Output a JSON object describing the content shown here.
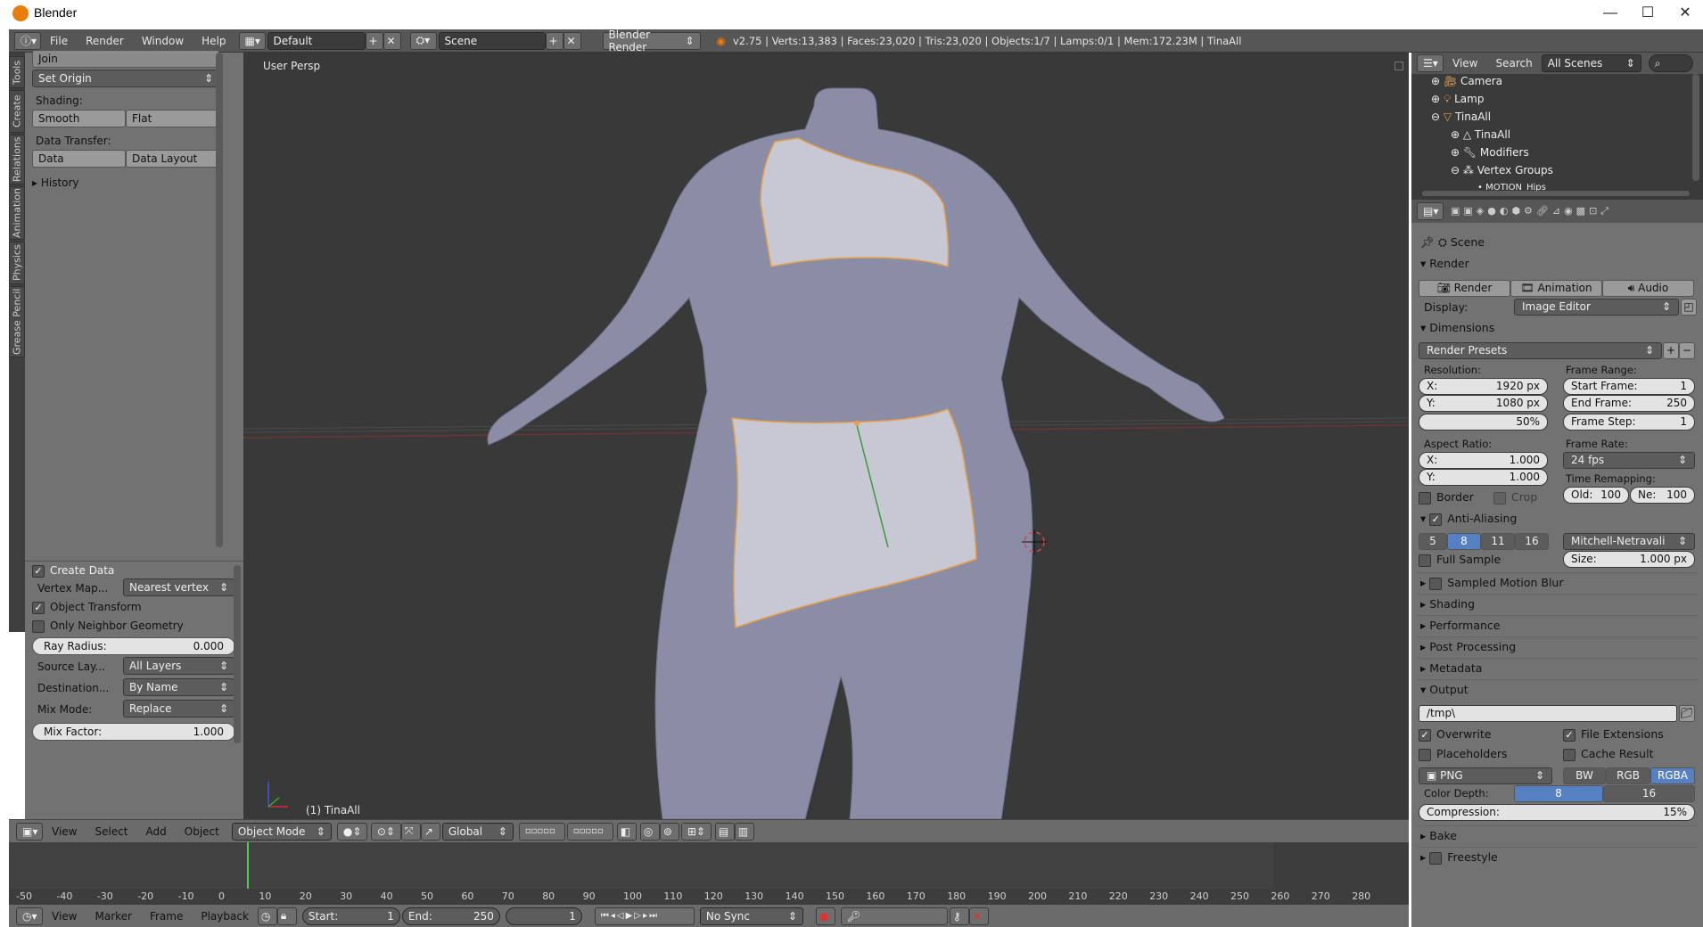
{
  "window": {
    "title": "Blender",
    "min": "—",
    "max": "☐",
    "close": "✕"
  },
  "info": {
    "menus": [
      "File",
      "Render",
      "Window",
      "Help"
    ],
    "layout": "Default",
    "scene": "Scene",
    "engine": "Blender Render",
    "stats": "v2.75 | Verts:13,383 | Faces:23,020 | Tris:23,020 | Objects:1/7 | Lamps:0/1 | Mem:172.23M | TinaAll"
  },
  "lefttabs": [
    "Tools",
    "Create",
    "Relations",
    "Animation",
    "Physics",
    "Grease Pencil"
  ],
  "tools": {
    "join": "Join",
    "set_origin": "Set Origin",
    "shading_label": "Shading:",
    "smooth": "Smooth",
    "flat": "Flat",
    "data_transfer_label": "Data Transfer:",
    "data": "Data",
    "data_layout": "Data Layout",
    "history": "History",
    "create_data": "Create Data",
    "vertex_map_label": "Vertex Map...",
    "vertex_map": "Nearest vertex",
    "object_transform": "Object Transform",
    "only_neighbor": "Only Neighbor Geometry",
    "ray_radius_label": "Ray Radius:",
    "ray_radius": "0.000",
    "source_layers_label": "Source Lay...",
    "source_layers": "All Layers",
    "destination_label": "Destination...",
    "destination": "By Name",
    "mix_mode_label": "Mix Mode:",
    "mix_mode": "Replace",
    "mix_factor_label": "Mix Factor:",
    "mix_factor": "1.000"
  },
  "viewport": {
    "persp": "User Persp",
    "object": "(1) TinaAll"
  },
  "vpheader": {
    "menus": [
      "View",
      "Select",
      "Add",
      "Object"
    ],
    "mode": "Object Mode",
    "orientation": "Global"
  },
  "timeline": {
    "ticks": [
      "-50",
      "-40",
      "-30",
      "-20",
      "-10",
      "0",
      "10",
      "20",
      "30",
      "40",
      "50",
      "60",
      "70",
      "80",
      "90",
      "100",
      "110",
      "120",
      "130",
      "140",
      "150",
      "160",
      "170",
      "180",
      "190",
      "200",
      "210",
      "220",
      "230",
      "240",
      "250",
      "260",
      "270",
      "280"
    ],
    "menus": [
      "View",
      "Marker",
      "Frame",
      "Playback"
    ],
    "start_label": "Start:",
    "start": "1",
    "end_label": "End:",
    "end": "250",
    "current": "1",
    "sync": "No Sync"
  },
  "outliner": {
    "view": "View",
    "search": "Search",
    "scenes": "All Scenes",
    "items": [
      "Camera",
      "Lamp",
      "TinaAll",
      "TinaAll",
      "Modifiers",
      "Vertex Groups",
      "MOTION_Hips"
    ]
  },
  "props": {
    "scene": "Scene",
    "render_header": "Render",
    "render_btn": "Render",
    "animation_btn": "Animation",
    "audio_btn": "Audio",
    "display_label": "Display:",
    "display": "Image Editor",
    "dimensions_header": "Dimensions",
    "presets": "Render Presets",
    "resolution_label": "Resolution:",
    "res_x_label": "X:",
    "res_x": "1920 px",
    "res_y_label": "Y:",
    "res_y": "1080 px",
    "res_pct": "50%",
    "frame_range_label": "Frame Range:",
    "start_label": "Start Frame:",
    "start": "1",
    "end_label": "End Frame:",
    "end": "250",
    "step_label": "Frame Step:",
    "step": "1",
    "aspect_label": "Aspect Ratio:",
    "asp_x": "1.000",
    "asp_y": "1.000",
    "frame_rate_label": "Frame Rate:",
    "fps": "24 fps",
    "remap_label": "Time Remapping:",
    "old_label": "Old:",
    "old": "100",
    "new_label": "Ne:",
    "new": "100",
    "border": "Border",
    "crop": "Crop",
    "aa_header": "Anti-Aliasing",
    "aa_samples": [
      "5",
      "8",
      "11",
      "16"
    ],
    "aa_filter": "Mitchell-Netravali",
    "full_sample": "Full Sample",
    "size_label": "Size:",
    "size": "1.000 px",
    "motion_blur": "Sampled Motion Blur",
    "shading": "Shading",
    "performance": "Performance",
    "post": "Post Processing",
    "metadata": "Metadata",
    "output": "Output",
    "path": "/tmp\\",
    "overwrite": "Overwrite",
    "file_ext": "File Extensions",
    "placeholders": "Placeholders",
    "cache": "Cache Result",
    "format": "PNG",
    "bw": "BW",
    "rgb": "RGB",
    "rgba": "RGBA",
    "depth_label": "Color Depth:",
    "depth8": "8",
    "depth16": "16",
    "compression_label": "Compression:",
    "compression": "15%",
    "bake": "Bake",
    "freestyle": "Freestyle"
  }
}
